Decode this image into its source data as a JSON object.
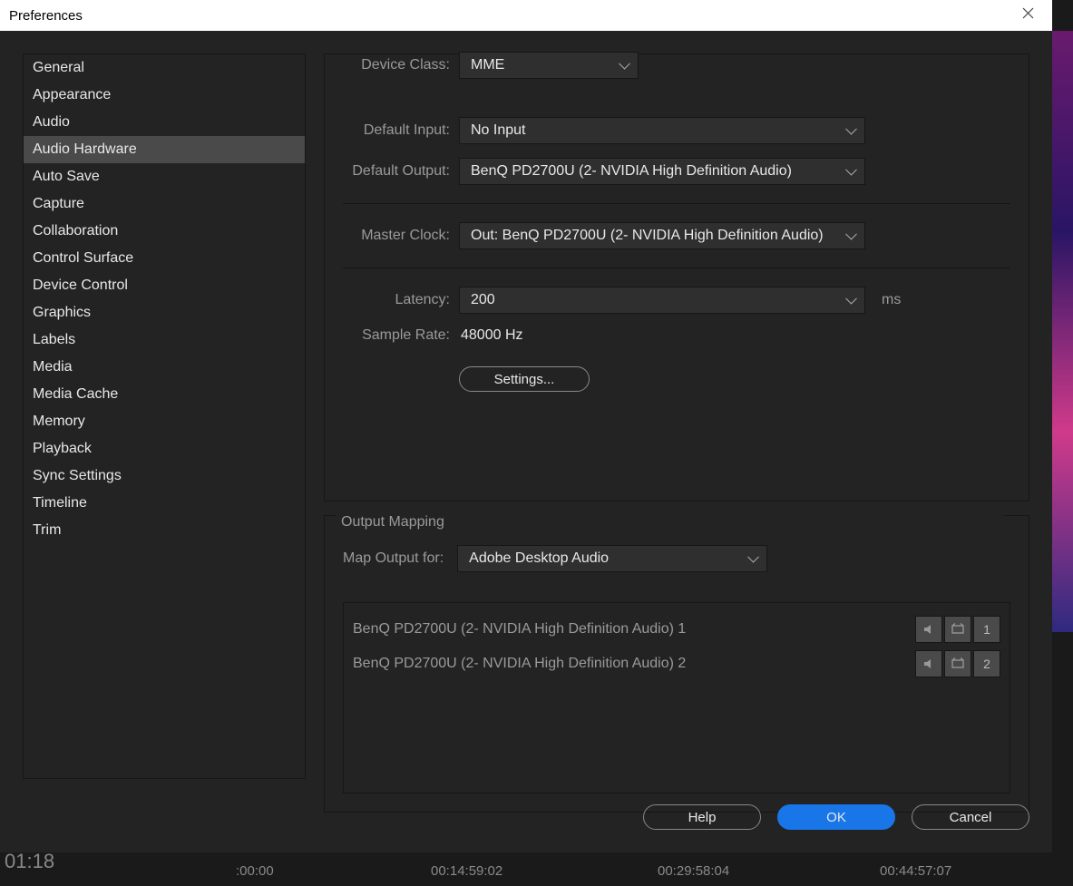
{
  "window": {
    "title": "Preferences"
  },
  "sidebar": {
    "items": [
      {
        "label": "General"
      },
      {
        "label": "Appearance"
      },
      {
        "label": "Audio"
      },
      {
        "label": "Audio Hardware",
        "selected": true
      },
      {
        "label": "Auto Save"
      },
      {
        "label": "Capture"
      },
      {
        "label": "Collaboration"
      },
      {
        "label": "Control Surface"
      },
      {
        "label": "Device Control"
      },
      {
        "label": "Graphics"
      },
      {
        "label": "Labels"
      },
      {
        "label": "Media"
      },
      {
        "label": "Media Cache"
      },
      {
        "label": "Memory"
      },
      {
        "label": "Playback"
      },
      {
        "label": "Sync Settings"
      },
      {
        "label": "Timeline"
      },
      {
        "label": "Trim"
      }
    ]
  },
  "main": {
    "device_class": {
      "label": "Device Class:",
      "value": "MME"
    },
    "default_input": {
      "label": "Default Input:",
      "value": "No Input"
    },
    "default_output": {
      "label": "Default Output:",
      "value": "BenQ PD2700U (2- NVIDIA High Definition Audio)"
    },
    "master_clock": {
      "label": "Master Clock:",
      "value": "Out: BenQ PD2700U (2- NVIDIA High Definition Audio)"
    },
    "latency": {
      "label": "Latency:",
      "value": "200",
      "unit": "ms"
    },
    "sample_rate": {
      "label": "Sample Rate:",
      "value": "48000 Hz"
    },
    "settings_btn": "Settings..."
  },
  "output_mapping": {
    "legend": "Output Mapping",
    "map_for_label": "Map Output for:",
    "map_for_value": "Adobe Desktop Audio",
    "channels": [
      {
        "name": "BenQ PD2700U (2- NVIDIA High Definition Audio) 1",
        "num": "1"
      },
      {
        "name": "BenQ PD2700U (2- NVIDIA High Definition Audio) 2",
        "num": "2"
      }
    ]
  },
  "footer": {
    "help": "Help",
    "ok": "OK",
    "cancel": "Cancel"
  },
  "timeline": {
    "left": "01:18",
    "ticks": [
      ":00:00",
      "00:14:59:02",
      "00:29:58:04",
      "00:44:57:07"
    ]
  }
}
